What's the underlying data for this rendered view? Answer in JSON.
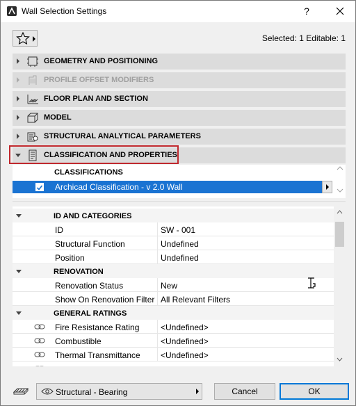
{
  "window": {
    "title": "Wall Selection Settings",
    "help_label": "?"
  },
  "toolbar": {
    "favorites_icon": "star-icon",
    "selected_info": "Selected: 1 Editable: 1"
  },
  "sections": [
    {
      "label": "GEOMETRY AND POSITIONING",
      "icon": "geometry-icon",
      "expanded": false,
      "enabled": true
    },
    {
      "label": "PROFILE OFFSET MODIFIERS",
      "icon": "profile-offset-icon",
      "expanded": false,
      "enabled": false
    },
    {
      "label": "FLOOR PLAN AND SECTION",
      "icon": "floor-plan-icon",
      "expanded": false,
      "enabled": true
    },
    {
      "label": "MODEL",
      "icon": "model-icon",
      "expanded": false,
      "enabled": true
    },
    {
      "label": "STRUCTURAL ANALYTICAL PARAMETERS",
      "icon": "structural-analytical-icon",
      "expanded": false,
      "enabled": true
    },
    {
      "label": "CLASSIFICATION AND PROPERTIES",
      "icon": "classification-icon",
      "expanded": true,
      "enabled": true
    }
  ],
  "classifications": {
    "header": "CLASSIFICATIONS",
    "row": {
      "checked": true,
      "text": "Archicad Classification - v 2.0 Wall"
    }
  },
  "properties": {
    "groups": [
      {
        "title": "ID AND CATEGORIES",
        "rows": [
          {
            "name": "ID",
            "value": "SW - 001"
          },
          {
            "name": "Structural Function",
            "value": "Undefined"
          },
          {
            "name": "Position",
            "value": "Undefined"
          }
        ]
      },
      {
        "title": "RENOVATION",
        "rows": [
          {
            "name": "Renovation Status",
            "value": "New"
          },
          {
            "name": "Show On Renovation Filter",
            "value": "All Relevant Filters"
          }
        ]
      },
      {
        "title": "GENERAL RATINGS",
        "rows": [
          {
            "name": "Fire Resistance Rating",
            "value": "<Undefined>"
          },
          {
            "name": "Combustible",
            "value": "<Undefined>"
          },
          {
            "name": "Thermal Transmittance",
            "value": "<Undefined>"
          }
        ]
      }
    ]
  },
  "footer": {
    "layer_icon": "eye-icon",
    "layer": "Structural - Bearing",
    "cancel_label": "Cancel",
    "ok_label": "OK"
  }
}
